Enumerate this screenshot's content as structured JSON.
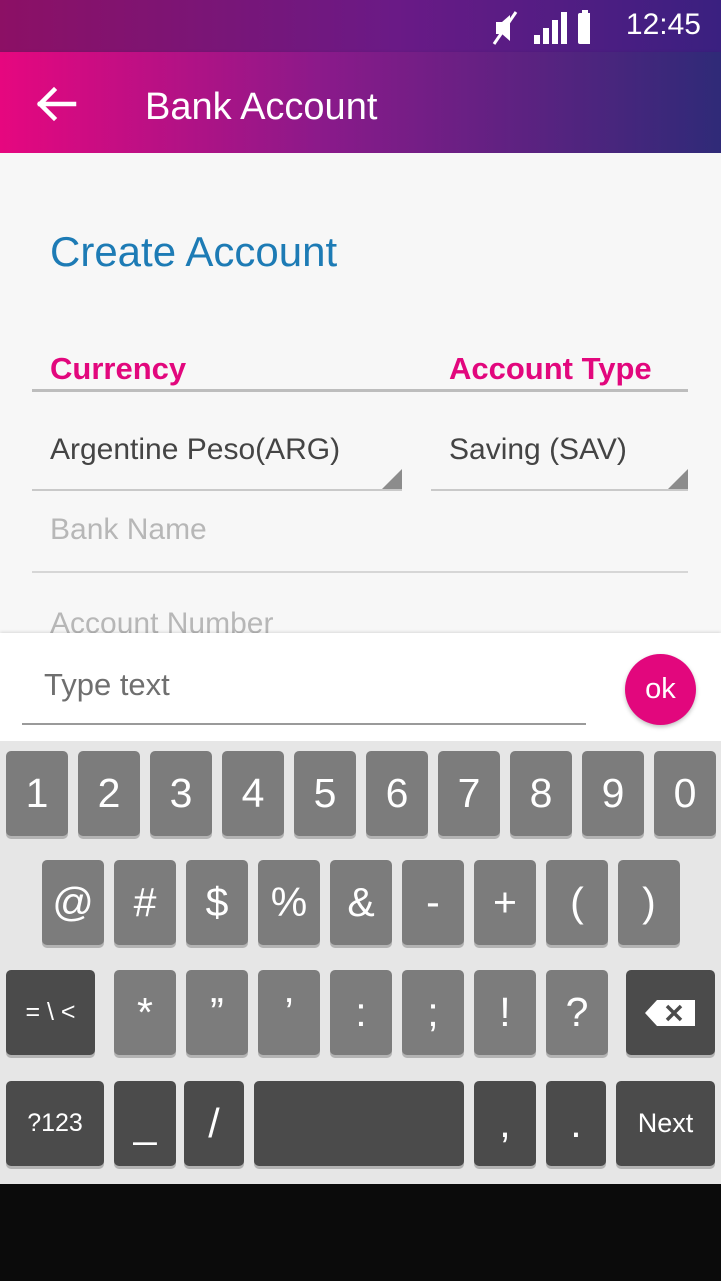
{
  "status_bar": {
    "time": "12:45"
  },
  "app_bar": {
    "title": "Bank Account"
  },
  "form": {
    "heading": "Create Account",
    "currency_label": "Currency",
    "account_type_label": "Account Type",
    "currency_value": "Argentine Peso(ARG)",
    "account_type_value": "Saving (SAV)",
    "bank_name_placeholder": "Bank Name",
    "account_number_placeholder": "Account Number"
  },
  "input_bar": {
    "placeholder": "Type text",
    "ok_label": "ok"
  },
  "keyboard": {
    "row1": [
      "1",
      "2",
      "3",
      "4",
      "5",
      "6",
      "7",
      "8",
      "9",
      "0"
    ],
    "row2": [
      "@",
      "#",
      "$",
      "%",
      "&",
      "-",
      "+",
      "(",
      ")"
    ],
    "row3": [
      "= \\ <",
      "*",
      "”",
      "’",
      ":",
      ";",
      "!",
      "?"
    ],
    "row4": [
      "?123",
      "_",
      "/",
      "",
      ",",
      ".",
      "Next"
    ]
  },
  "colors": {
    "accent": "#e2077d",
    "heading": "#1d7bb5",
    "appbar_start": "#e6077f",
    "appbar_end": "#2f2a78"
  }
}
